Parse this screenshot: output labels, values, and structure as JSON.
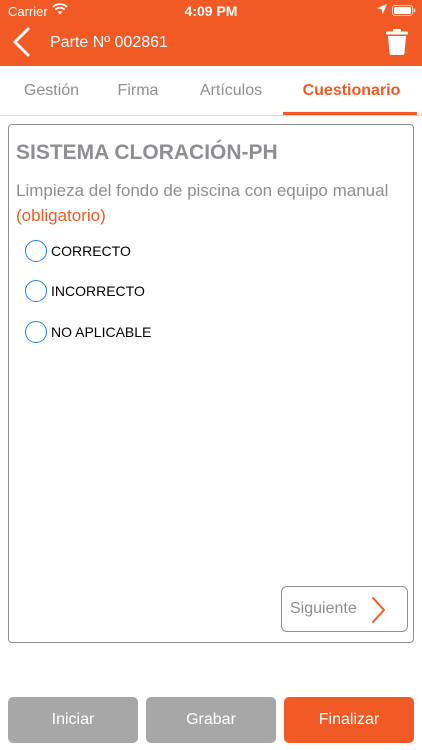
{
  "status_bar": {
    "carrier": "Carrier",
    "time": "4:09 PM"
  },
  "header": {
    "title": "Parte Nº 002861"
  },
  "tabs": [
    {
      "label": "Gestión",
      "active": false
    },
    {
      "label": "Firma",
      "active": false
    },
    {
      "label": "Artículos",
      "active": false
    },
    {
      "label": "Cuestionario",
      "active": true
    }
  ],
  "questionnaire": {
    "section_title": "SISTEMA CLORACIÓN-PH",
    "question": "Limpieza del fondo de piscina con equipo manual",
    "required_label": "(obligatorio)",
    "options": [
      {
        "label": "CORRECTO",
        "selected": false
      },
      {
        "label": "INCORRECTO",
        "selected": false
      },
      {
        "label": "NO APLICABLE",
        "selected": false
      }
    ],
    "next_label": "Siguiente"
  },
  "actions": {
    "start_label": "Iniciar",
    "save_label": "Grabar",
    "finish_label": "Finalizar"
  },
  "colors": {
    "accent": "#f15a24",
    "radio": "#1e88e5",
    "muted_text": "#8e8e93",
    "button_gray": "#a7a7a7"
  }
}
